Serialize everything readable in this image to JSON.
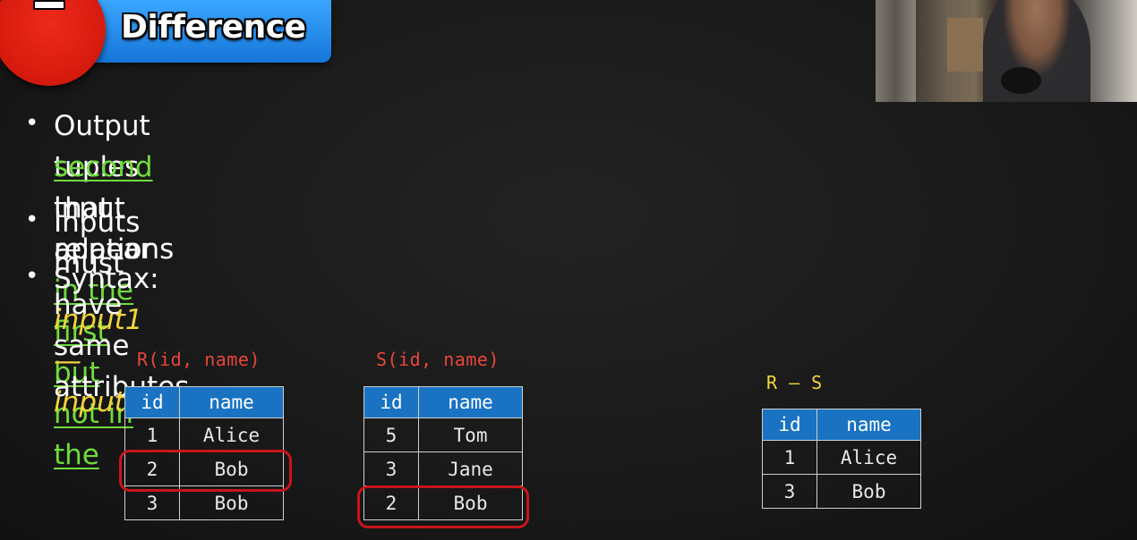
{
  "slide": {
    "badge_symbol": "—",
    "title": "Difference"
  },
  "bullets": [
    {
      "line1_pre": "Output tuples that appear ",
      "line1_hl": "in the first but not in the",
      "line2_hl": "second",
      "line2_post": " input relations"
    },
    {
      "text": "Inputs must have same attributes"
    },
    {
      "label": "Syntax: ",
      "value": "input1 — input2"
    }
  ],
  "tables": {
    "r": {
      "caption": "R(id, name)",
      "headers": [
        "id",
        "name"
      ],
      "rows": [
        [
          "1",
          "Alice"
        ],
        [
          "2",
          "Bob"
        ],
        [
          "3",
          "Bob"
        ]
      ]
    },
    "s": {
      "caption": "S(id, name)",
      "headers": [
        "id",
        "name"
      ],
      "rows": [
        [
          "5",
          "Tom"
        ],
        [
          "3",
          "Jane"
        ],
        [
          "2",
          "Bob"
        ]
      ]
    },
    "result": {
      "caption": "R — S",
      "headers": [
        "id",
        "name"
      ],
      "rows": [
        [
          "1",
          "Alice"
        ],
        [
          "3",
          "Bob"
        ]
      ]
    }
  },
  "colors": {
    "title_bar": "#1f86e8",
    "badge": "#d41a0d",
    "highlight": "#6fdc3c",
    "syntax": "#f2d53c",
    "caption": "#e8473a",
    "table_header": "#1a73c2",
    "ring": "#c8151b"
  }
}
